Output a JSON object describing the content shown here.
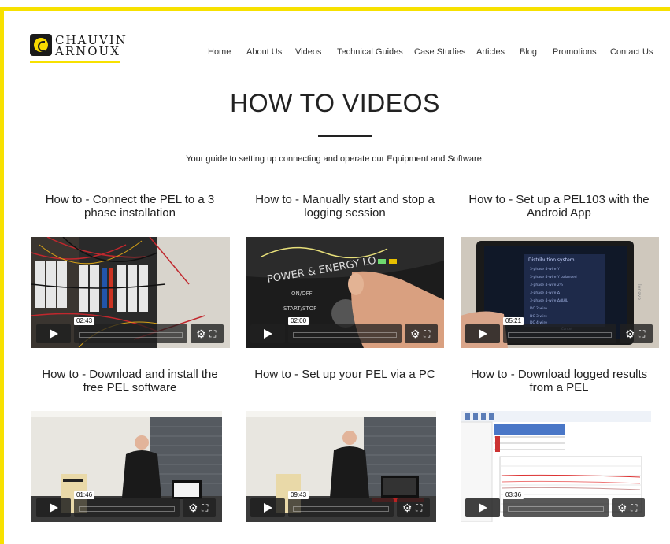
{
  "brand": {
    "line1": "CHAUVIN",
    "line2": "ARNOUX",
    "accent": "#f7e100"
  },
  "nav": {
    "items": [
      "Home",
      "About Us",
      "Videos",
      "Technical Guides",
      "Case Studies",
      "Articles",
      "Blog",
      "Promotions",
      "Contact Us"
    ]
  },
  "page": {
    "title": "HOW TO VIDEOS",
    "subtitle": "Your guide to setting up connecting and operate our Equipment and Software."
  },
  "videos": [
    {
      "title_line1": "How to - Connect the PEL to a 3",
      "title_line2": "phase installation",
      "time": "02:43",
      "icon": "play-icon"
    },
    {
      "title_line1": "How to - Manually start and stop a",
      "title_line2": "logging session",
      "time": "02:00",
      "icon": "play-icon"
    },
    {
      "title_line1": "How to - Set up a PEL103 with the",
      "title_line2": "Android App",
      "time": "05:21",
      "icon": "play-icon"
    },
    {
      "title_line1": "How to - Download and install the",
      "title_line2": "free PEL software",
      "time": "01:46",
      "icon": "play-icon"
    },
    {
      "title_line1": "How to - Set up your PEL via a PC",
      "title_line2": "",
      "time": "09:43",
      "icon": "play-icon"
    },
    {
      "title_line1": "How to - Download logged results",
      "title_line2": "from a PEL",
      "time": "03:36",
      "icon": "play-icon"
    }
  ],
  "pel_label": "POWER & ENERGY LO",
  "device_labels": {
    "on_off": "ON/OFF",
    "start_stop": "START/STOP"
  },
  "tablet": {
    "header": "Distribution system",
    "rows": [
      "3-phase 4-wire Y",
      "3-phase 4-wire Y balanced",
      "3-phase 4-wire 2½",
      "3-phase 4-wire Δ",
      "3-phase 4-wire Δ/ΔHL",
      "DC 2-wire",
      "DC 3-wire",
      "DC 4-wire"
    ],
    "footer": "Cancel",
    "brand": "lenovo"
  }
}
